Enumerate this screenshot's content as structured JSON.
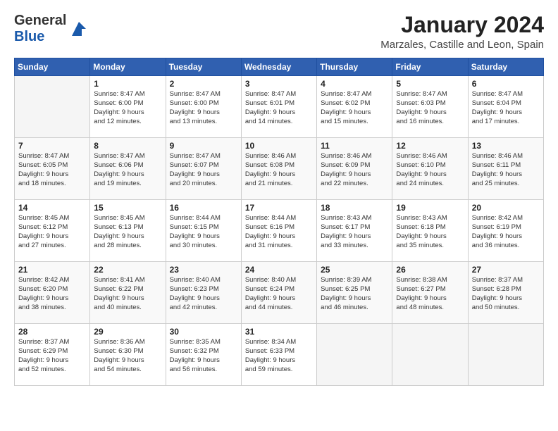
{
  "logo": {
    "general": "General",
    "blue": "Blue"
  },
  "title": "January 2024",
  "location": "Marzales, Castille and Leon, Spain",
  "days_header": [
    "Sunday",
    "Monday",
    "Tuesday",
    "Wednesday",
    "Thursday",
    "Friday",
    "Saturday"
  ],
  "weeks": [
    [
      {
        "num": "",
        "info": ""
      },
      {
        "num": "1",
        "info": "Sunrise: 8:47 AM\nSunset: 6:00 PM\nDaylight: 9 hours\nand 12 minutes."
      },
      {
        "num": "2",
        "info": "Sunrise: 8:47 AM\nSunset: 6:00 PM\nDaylight: 9 hours\nand 13 minutes."
      },
      {
        "num": "3",
        "info": "Sunrise: 8:47 AM\nSunset: 6:01 PM\nDaylight: 9 hours\nand 14 minutes."
      },
      {
        "num": "4",
        "info": "Sunrise: 8:47 AM\nSunset: 6:02 PM\nDaylight: 9 hours\nand 15 minutes."
      },
      {
        "num": "5",
        "info": "Sunrise: 8:47 AM\nSunset: 6:03 PM\nDaylight: 9 hours\nand 16 minutes."
      },
      {
        "num": "6",
        "info": "Sunrise: 8:47 AM\nSunset: 6:04 PM\nDaylight: 9 hours\nand 17 minutes."
      }
    ],
    [
      {
        "num": "7",
        "info": "Sunrise: 8:47 AM\nSunset: 6:05 PM\nDaylight: 9 hours\nand 18 minutes."
      },
      {
        "num": "8",
        "info": "Sunrise: 8:47 AM\nSunset: 6:06 PM\nDaylight: 9 hours\nand 19 minutes."
      },
      {
        "num": "9",
        "info": "Sunrise: 8:47 AM\nSunset: 6:07 PM\nDaylight: 9 hours\nand 20 minutes."
      },
      {
        "num": "10",
        "info": "Sunrise: 8:46 AM\nSunset: 6:08 PM\nDaylight: 9 hours\nand 21 minutes."
      },
      {
        "num": "11",
        "info": "Sunrise: 8:46 AM\nSunset: 6:09 PM\nDaylight: 9 hours\nand 22 minutes."
      },
      {
        "num": "12",
        "info": "Sunrise: 8:46 AM\nSunset: 6:10 PM\nDaylight: 9 hours\nand 24 minutes."
      },
      {
        "num": "13",
        "info": "Sunrise: 8:46 AM\nSunset: 6:11 PM\nDaylight: 9 hours\nand 25 minutes."
      }
    ],
    [
      {
        "num": "14",
        "info": "Sunrise: 8:45 AM\nSunset: 6:12 PM\nDaylight: 9 hours\nand 27 minutes."
      },
      {
        "num": "15",
        "info": "Sunrise: 8:45 AM\nSunset: 6:13 PM\nDaylight: 9 hours\nand 28 minutes."
      },
      {
        "num": "16",
        "info": "Sunrise: 8:44 AM\nSunset: 6:15 PM\nDaylight: 9 hours\nand 30 minutes."
      },
      {
        "num": "17",
        "info": "Sunrise: 8:44 AM\nSunset: 6:16 PM\nDaylight: 9 hours\nand 31 minutes."
      },
      {
        "num": "18",
        "info": "Sunrise: 8:43 AM\nSunset: 6:17 PM\nDaylight: 9 hours\nand 33 minutes."
      },
      {
        "num": "19",
        "info": "Sunrise: 8:43 AM\nSunset: 6:18 PM\nDaylight: 9 hours\nand 35 minutes."
      },
      {
        "num": "20",
        "info": "Sunrise: 8:42 AM\nSunset: 6:19 PM\nDaylight: 9 hours\nand 36 minutes."
      }
    ],
    [
      {
        "num": "21",
        "info": "Sunrise: 8:42 AM\nSunset: 6:20 PM\nDaylight: 9 hours\nand 38 minutes."
      },
      {
        "num": "22",
        "info": "Sunrise: 8:41 AM\nSunset: 6:22 PM\nDaylight: 9 hours\nand 40 minutes."
      },
      {
        "num": "23",
        "info": "Sunrise: 8:40 AM\nSunset: 6:23 PM\nDaylight: 9 hours\nand 42 minutes."
      },
      {
        "num": "24",
        "info": "Sunrise: 8:40 AM\nSunset: 6:24 PM\nDaylight: 9 hours\nand 44 minutes."
      },
      {
        "num": "25",
        "info": "Sunrise: 8:39 AM\nSunset: 6:25 PM\nDaylight: 9 hours\nand 46 minutes."
      },
      {
        "num": "26",
        "info": "Sunrise: 8:38 AM\nSunset: 6:27 PM\nDaylight: 9 hours\nand 48 minutes."
      },
      {
        "num": "27",
        "info": "Sunrise: 8:37 AM\nSunset: 6:28 PM\nDaylight: 9 hours\nand 50 minutes."
      }
    ],
    [
      {
        "num": "28",
        "info": "Sunrise: 8:37 AM\nSunset: 6:29 PM\nDaylight: 9 hours\nand 52 minutes."
      },
      {
        "num": "29",
        "info": "Sunrise: 8:36 AM\nSunset: 6:30 PM\nDaylight: 9 hours\nand 54 minutes."
      },
      {
        "num": "30",
        "info": "Sunrise: 8:35 AM\nSunset: 6:32 PM\nDaylight: 9 hours\nand 56 minutes."
      },
      {
        "num": "31",
        "info": "Sunrise: 8:34 AM\nSunset: 6:33 PM\nDaylight: 9 hours\nand 59 minutes."
      },
      {
        "num": "",
        "info": ""
      },
      {
        "num": "",
        "info": ""
      },
      {
        "num": "",
        "info": ""
      }
    ]
  ]
}
